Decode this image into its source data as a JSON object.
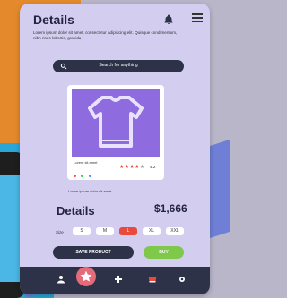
{
  "header": {
    "title": "Details",
    "description": "Lorem ipsum dolor sit amet, consectetur adipiscing elit. Quisque condimentum, nibh risus lobortis, gravida"
  },
  "search": {
    "placeholder": "Search for anything"
  },
  "product": {
    "name": "Lorem sit amet",
    "rating": "4.2",
    "color_dots": [
      "#ff4d4d",
      "#35c46a",
      "#3a8bff"
    ],
    "caption": "Lorem ipsum dolor sit amet"
  },
  "details": {
    "title": "Details",
    "price": "$1,666"
  },
  "sizes": {
    "label": "Size",
    "options": [
      "S",
      "M",
      "L",
      "XL",
      "XXL"
    ],
    "selected": "L"
  },
  "actions": {
    "save_label": "SAVE PRODUCT",
    "buy_label": "BUY"
  },
  "nav": {
    "items": [
      "profile-icon",
      "star-icon",
      "plus-icon",
      "cart-icon",
      "settings-icon"
    ]
  },
  "colors": {
    "dark": "#2d3248",
    "accent_red": "#e94a3b",
    "accent_green": "#7ec84a",
    "product_bg": "#8f6be0"
  }
}
